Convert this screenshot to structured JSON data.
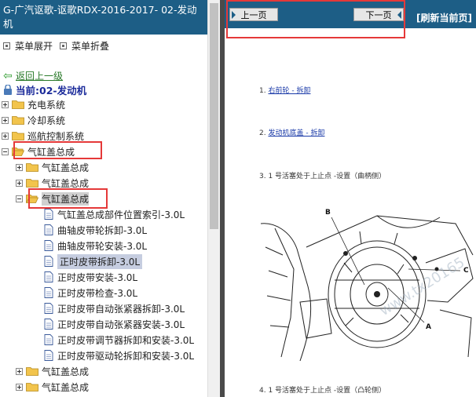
{
  "left_pane": {
    "title": "G-广汽讴歌-讴歌RDX-2016-2017- 02-发动机",
    "menu_expand": "菜单展开",
    "menu_collapse": "菜单折叠",
    "back_link": "返回上一级",
    "current_label": "当前:02-发动机",
    "tree": [
      {
        "label": "充电系统",
        "level": 0,
        "kind": "folder"
      },
      {
        "label": "冷却系统",
        "level": 0,
        "kind": "folder"
      },
      {
        "label": "巡航控制系统",
        "level": 0,
        "kind": "folder"
      },
      {
        "label": "气缸盖总成",
        "level": 0,
        "kind": "folder-open"
      },
      {
        "label": "气缸盖总成",
        "level": 1,
        "kind": "folder"
      },
      {
        "label": "气缸盖总成",
        "level": 1,
        "kind": "folder"
      },
      {
        "label": "气缸盖总成",
        "level": 1,
        "kind": "folder-open",
        "selected": true
      },
      {
        "label": "气缸盖总成部件位置索引-3.0L",
        "level": 2,
        "kind": "doc"
      },
      {
        "label": "曲轴皮带轮拆卸-3.0L",
        "level": 2,
        "kind": "doc"
      },
      {
        "label": "曲轴皮带轮安装-3.0L",
        "level": 2,
        "kind": "doc"
      },
      {
        "label": "正时皮带拆卸-3.0L",
        "level": 2,
        "kind": "doc",
        "active": true
      },
      {
        "label": "正时皮带安装-3.0L",
        "level": 2,
        "kind": "doc"
      },
      {
        "label": "正时皮带检查-3.0L",
        "level": 2,
        "kind": "doc"
      },
      {
        "label": "正时皮带自动张紧器拆卸-3.0L",
        "level": 2,
        "kind": "doc"
      },
      {
        "label": "正时皮带自动张紧器安装-3.0L",
        "level": 2,
        "kind": "doc"
      },
      {
        "label": "正时皮带调节器拆卸和安装-3.0L",
        "level": 2,
        "kind": "doc"
      },
      {
        "label": "正时皮带驱动轮拆卸和安装-3.0L",
        "level": 2,
        "kind": "doc"
      },
      {
        "label": "气缸盖总成",
        "level": 1,
        "kind": "folder"
      },
      {
        "label": "气缸盖总成",
        "level": 1,
        "kind": "folder"
      }
    ]
  },
  "right_pane": {
    "prev_page": "上一页",
    "next_page": "下一页",
    "refresh": "[刷新当前页]",
    "steps": [
      {
        "num": "1.",
        "link": "右前轮 - 拆卸",
        "text": ""
      },
      {
        "num": "2.",
        "link": "发动机底盖 - 拆卸",
        "text": ""
      },
      {
        "num": "3.",
        "link": "",
        "text": "1 号活塞处于上止点 -设置（曲柄侧）"
      },
      {
        "num": "4.",
        "link": "",
        "text": "1 号活塞处于上止点 -设置（凸轮侧）"
      }
    ],
    "diagram_labels": [
      "B",
      "C",
      "A"
    ],
    "watermark": "www.tx20165"
  },
  "colors": {
    "title_bar": "#1d5e86",
    "highlight_box": "#e53939",
    "selection": "#c6cde0",
    "link": "#1a3aa8"
  }
}
